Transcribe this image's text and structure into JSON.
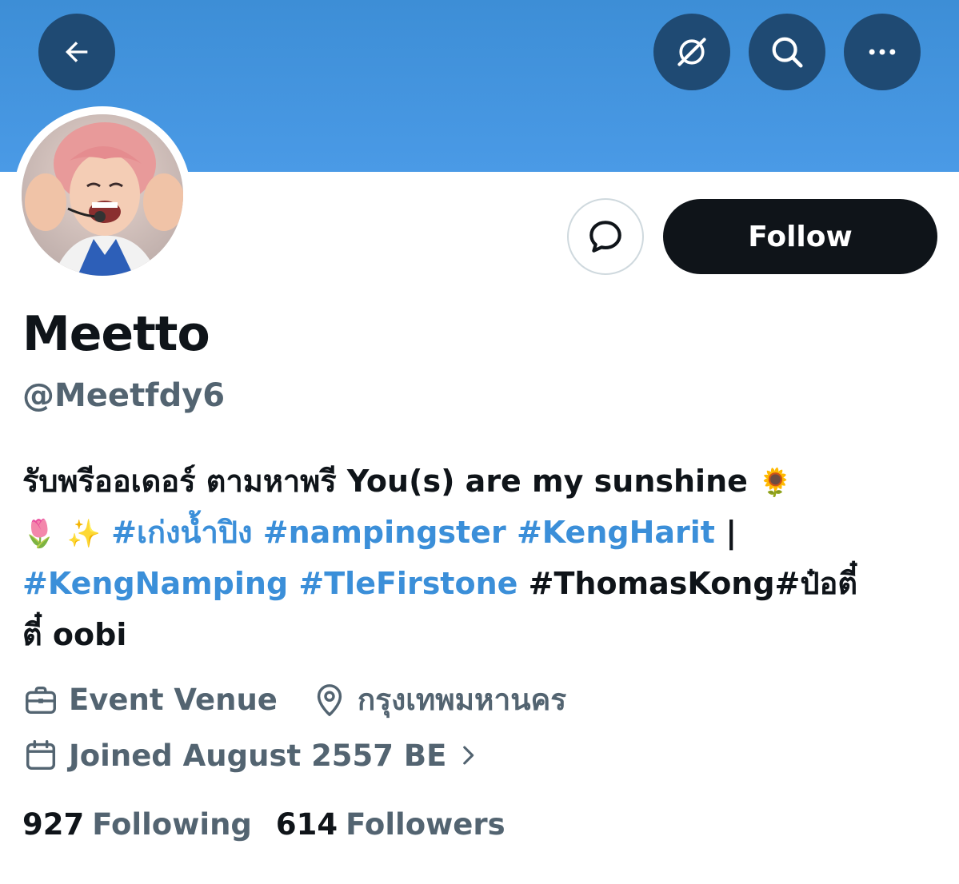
{
  "banner": {
    "color": "#4a9ae6"
  },
  "topbar": {
    "back_icon": "arrow-left-icon",
    "grok_icon": "slashed-circle-icon",
    "search_icon": "search-icon",
    "more_icon": "more-horizontal-icon"
  },
  "profile": {
    "display_name": "Meetto",
    "handle": "@Meetfdy6",
    "follow_label": "Follow",
    "message_icon": "message-bubble-icon"
  },
  "bio": {
    "line1_text": "รับพรีออเดอร์ ตามหาพรี You(s) are my sunshine ",
    "line1_emoji": "🌻",
    "line2_emoji_a": "🌷",
    "line2_emoji_b": "✨",
    "tag1": "#เก่งน้ำปิง",
    "tag2": "#nampingster",
    "tag3": "#KengHarit",
    "separator": "|",
    "tag4": "#KengNamping",
    "tag5": "#TleFirstone",
    "line3_tail": "#ThomasKong#ป๋อตี๋",
    "line4_text": "ตี๋ oobi"
  },
  "meta": {
    "category": "Event Venue",
    "location": "กรุงเทพมหานคร",
    "joined": "Joined August 2557 BE"
  },
  "stats": {
    "following_count": "927",
    "following_label": "Following",
    "followers_count": "614",
    "followers_label": "Followers"
  },
  "colors": {
    "accent": "#1d9bf0",
    "muted": "#536471",
    "text": "#0f1419",
    "button_dark": "#1f4a73"
  }
}
